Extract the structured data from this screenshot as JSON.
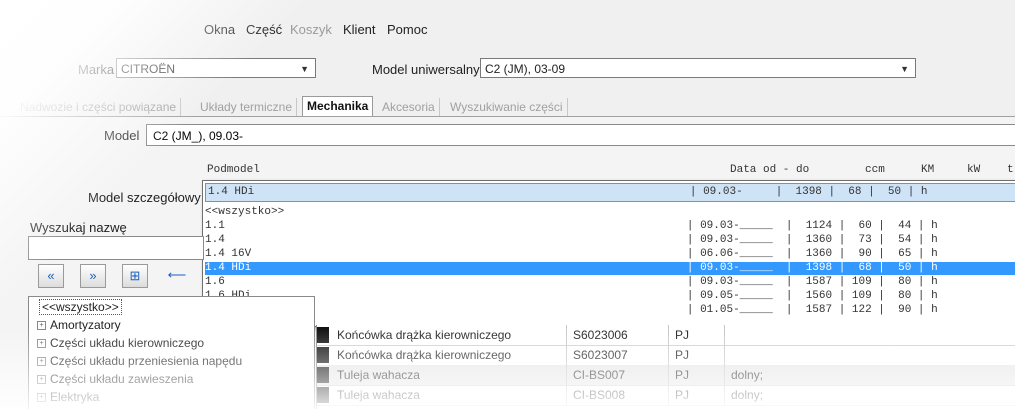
{
  "menu": {
    "items": [
      {
        "label": "Okna",
        "disabled": false
      },
      {
        "label": "Część",
        "disabled": false
      },
      {
        "label": "Koszyk",
        "disabled": true
      },
      {
        "label": "Klient",
        "disabled": false
      },
      {
        "label": "Pomoc",
        "disabled": false
      }
    ]
  },
  "filters": {
    "marka_label": "Marka",
    "marka_value": "CITROËN",
    "model_uni_label": "Model uniwersalny",
    "model_uni_value": "C2 (JM), 03-09"
  },
  "tabs": [
    {
      "label": "Nadwozie i części powiązane",
      "active": false
    },
    {
      "label": "Układy termiczne",
      "active": false
    },
    {
      "label": "Mechanika",
      "active": true
    },
    {
      "label": "Akcesoria",
      "active": false
    },
    {
      "label": "Wyszukiwanie części",
      "active": false
    }
  ],
  "model": {
    "label": "Model",
    "value": "C2 (JM_), 09.03-"
  },
  "submodel": {
    "label": "Model szczegółowy",
    "headers": {
      "podmodel": "Podmodel",
      "data": "Data od - do",
      "ccm": "ccm",
      "km": "KM",
      "kw": "kW",
      "extra": "t"
    },
    "selected_text": "1.4 HDi                                                                  | 09.03-     |  1398 |  68 |  50 | h",
    "rows": [
      {
        "text": "<<wszystko>>",
        "highlight": false
      },
      {
        "text": "1.1                                                                      | 09.03-_____  |  1124 |  60 |  44 | h",
        "highlight": false
      },
      {
        "text": "1.4                                                                      | 09.03-_____  |  1360 |  73 |  54 | h",
        "highlight": false
      },
      {
        "text": "1.4 16V                                                                  | 06.06-_____  |  1360 |  90 |  65 | h",
        "highlight": false
      },
      {
        "text": "1.4 HDi                                                                  | 09.03-_____  |  1398 |  68 |  50 | h",
        "highlight": true
      },
      {
        "text": "1.6                                                                      | 09.03-_____  |  1587 | 109 |  80 | h",
        "highlight": false
      },
      {
        "text": "1.6 HDi                                                                  | 09.05-_____  |  1560 | 109 |  80 | h",
        "highlight": false
      },
      {
        "text": "1.6 VTS                                                                  | 01.05-_____  |  1587 | 122 |  90 | h",
        "highlight": false
      }
    ]
  },
  "search": {
    "label": "Wyszukaj nazwę",
    "value": ""
  },
  "toolbar": {
    "btn1": "«",
    "btn2": "»",
    "btn3": "⊞",
    "btn4": "⟵"
  },
  "tree": {
    "items": [
      {
        "label": "<<wszystko>>",
        "expand": "",
        "selected": true
      },
      {
        "label": "Amortyzatory",
        "expand": "+",
        "selected": false
      },
      {
        "label": "Części układu kierowniczego",
        "expand": "+",
        "selected": false
      },
      {
        "label": "Części układu przeniesienia napędu",
        "expand": "+",
        "selected": false
      },
      {
        "label": "Części układu zawieszenia",
        "expand": "+",
        "selected": false
      },
      {
        "label": "Elektryka",
        "expand": "+",
        "selected": false
      }
    ]
  },
  "grid": {
    "rows": [
      {
        "name": "Końcówka drążka kierowniczego",
        "code": "S6023006",
        "unit": "PJ",
        "note": ""
      },
      {
        "name": "Końcówka drążka kierowniczego",
        "code": "S6023007",
        "unit": "PJ",
        "note": ""
      },
      {
        "name": "Tuleja wahacza",
        "code": "CI-BS007",
        "unit": "PJ",
        "note": "dolny;"
      },
      {
        "name": "Tuleja wahacza",
        "code": "CI-BS008",
        "unit": "PJ",
        "note": "dolny;"
      }
    ]
  }
}
